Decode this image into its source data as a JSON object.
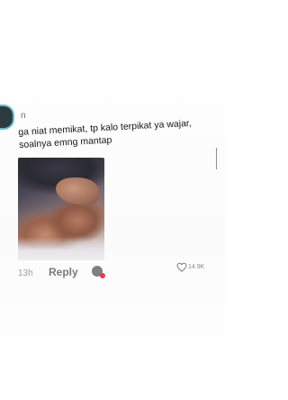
{
  "comment": {
    "username": "n",
    "text": "ga niat memikat, tp kalo terpikat ya wajar, soalnya emng mantap",
    "timestamp": "13h",
    "reply_label": "Reply",
    "like_count": "14.9K"
  },
  "icons": {
    "avatar": "user-avatar",
    "reply_avatar": "creator-avatar-with-heart",
    "like": "heart-outline-icon"
  },
  "colors": {
    "avatar_ring": "#6fb8c7",
    "heart_badge": "#e23b56",
    "text_primary": "#151515",
    "text_secondary": "#9c9c9c"
  }
}
